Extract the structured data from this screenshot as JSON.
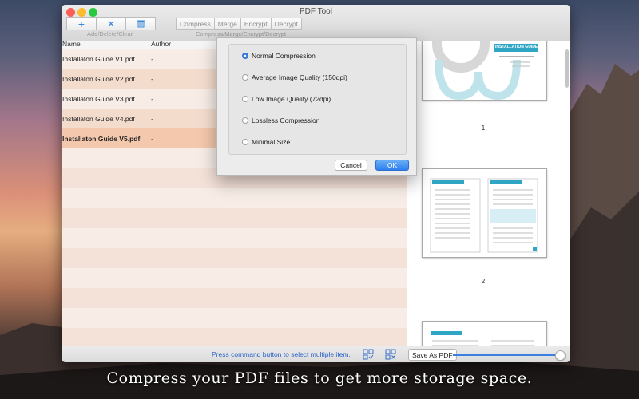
{
  "window": {
    "title": "PDF Tool"
  },
  "toolbar": {
    "buttons": [
      {
        "name": "add",
        "glyph": "+"
      },
      {
        "name": "delete",
        "glyph": "✕"
      },
      {
        "name": "clear",
        "glyph": "🗑"
      }
    ],
    "left_group_label": "Add/Delete/Clear",
    "segments": [
      "Compress",
      "Merge",
      "Encrypt",
      "Decrypt"
    ],
    "segments_label": "Compress/Merge/Encrypt/Decrypt"
  },
  "file_list": {
    "columns": [
      "Name",
      "Author"
    ],
    "rows": [
      {
        "name": "Installaton Guide V1.pdf",
        "author": "-"
      },
      {
        "name": "Installaton Guide V2.pdf",
        "author": "-"
      },
      {
        "name": "Installaton Guide V3.pdf",
        "author": "-"
      },
      {
        "name": "Installaton Guide V4.pdf",
        "author": "-"
      },
      {
        "name": "Installaton Guide V5.pdf",
        "author": "-",
        "selected": true
      }
    ]
  },
  "compress_dialog": {
    "options": [
      {
        "label": "Normal Compression",
        "selected": true
      },
      {
        "label": "Average Image Quality (150dpi)",
        "selected": false
      },
      {
        "label": "Low Image Quality (72dpi)",
        "selected": false
      },
      {
        "label": "Lossless Compression",
        "selected": false
      },
      {
        "label": "Minimal Size",
        "selected": false
      }
    ],
    "cancel_label": "Cancel",
    "ok_label": "OK"
  },
  "preview": {
    "cover_title": "INSTALLATION GUIDE",
    "page_numbers": [
      "1",
      "2"
    ]
  },
  "bottom_bar": {
    "hint": "Press command button to select multiple item.",
    "save_as_label": "Save As PDF",
    "zoom_fraction": 0.97
  },
  "caption": "Compress your PDF files to get more storage space.",
  "colors": {
    "accent": "#3d7fe0",
    "selected_row": "#f3c8ac",
    "hint_text": "#2a62c8"
  }
}
